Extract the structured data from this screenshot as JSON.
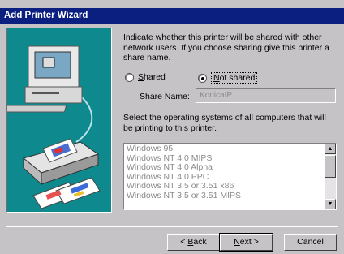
{
  "window": {
    "title": "Add Printer Wizard"
  },
  "intro_text": "Indicate whether this printer will be shared with other network users.  If you choose sharing give this printer a share name.",
  "sharing": {
    "shared_label": "Shared",
    "not_shared_label": "Not shared",
    "selected": "Not shared"
  },
  "share_name": {
    "label": "Share Name:",
    "value": "KonicaIP"
  },
  "os_prompt": "Select the operating systems of all computers that will be printing to this printer.",
  "os_list": [
    "Windows 95",
    "Windows NT 4.0 MIPS",
    "Windows NT 4.0 Alpha",
    "Windows NT 4.0 PPC",
    "Windows NT 3.5 or 3.51 x86",
    "Windows NT 3.5 or 3.51 MIPS"
  ],
  "buttons": {
    "back": "< Back",
    "next": "Next >",
    "cancel": "Cancel"
  },
  "colors": {
    "titlebar": "#0a1f80",
    "illustration_bg": "#0e8a8e",
    "face": "#c6c3c6"
  },
  "icons": [
    "computer-icon",
    "network-cable",
    "printer-icon",
    "printed-pages-icon"
  ]
}
